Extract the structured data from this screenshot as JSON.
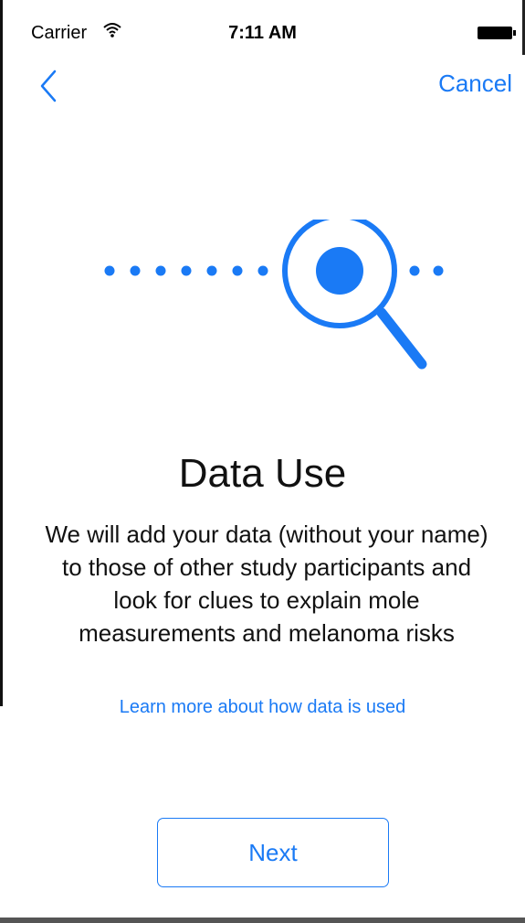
{
  "status_bar": {
    "carrier": "Carrier",
    "time": "7:11 AM",
    "wifi_icon": "wifi-icon",
    "battery_icon": "battery-icon"
  },
  "nav": {
    "back_icon": "chevron-left-icon",
    "cancel_label": "Cancel"
  },
  "illustration": {
    "icon": "magnifying-glass-icon"
  },
  "content": {
    "title": "Data Use",
    "body": "We will add your data (without your name) to those of other study participants and look for clues to explain mole measurements and melanoma risks",
    "learn_more_label": "Learn more about how data is used"
  },
  "actions": {
    "next_label": "Next"
  },
  "colors": {
    "accent": "#1a7af5",
    "text": "#111111",
    "background": "#ffffff"
  }
}
